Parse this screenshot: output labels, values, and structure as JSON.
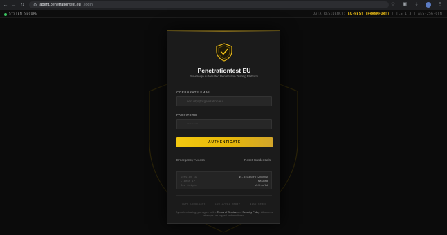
{
  "browser": {
    "url_host": "agent.penetrationtest.eu",
    "url_path": "/login",
    "nav_icons": [
      "back-icon",
      "forward-icon",
      "reload-icon"
    ],
    "right_icons": [
      "star-icon",
      "extensions-icon",
      "download-icon",
      "profile-avatar",
      "menu-icon"
    ]
  },
  "status": {
    "system": "SYSTEM SECURE",
    "residency_prefix": "DATA RESIDENCY:",
    "residency_region": "EU-WEST (FRANKFURT)",
    "residency_suffix": "| TLS 1.3 | AES-256-GCM"
  },
  "login": {
    "title": "Penetrationtest EU",
    "subtitle": "Sovereign Automated Penetration Testing Platform",
    "email_label": "CORPORATE EMAIL",
    "email_placeholder": "security@organization.eu",
    "password_label": "PASSWORD",
    "password_placeholder": "••••••••••",
    "authenticate_label": "AUTHENTICATE",
    "emergency_link": "Emergency Access",
    "reset_link": "Reset Credentials",
    "meta": [
      {
        "key": "Session ID",
        "value": "NS-54C3B4F7E2N5C6D"
      },
      {
        "key": "Client IP",
        "value": "Masked"
      },
      {
        "key": "Geo Origin",
        "value": "Withheld"
      }
    ],
    "badges": [
      "GDPR Compliant",
      "ISO 27001 Ready",
      "NIS2 Ready"
    ],
    "terms_before": "By authenticating, you agree to the",
    "terms_link_1": "Terms of Service",
    "terms_and": "and",
    "terms_link_2": "Security Policy",
    "terms_after": ". All access attempts are logged and monitored."
  },
  "colors": {
    "accent": "#F3C316",
    "background": "#0B0B0B",
    "card": "#1B1B1B",
    "status_ok": "#3BC35F"
  }
}
